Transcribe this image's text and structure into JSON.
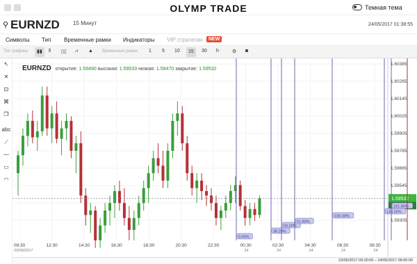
{
  "app": {
    "logo": "OLYMP TRADE",
    "theme_label": "Темная тема"
  },
  "header": {
    "symbol": "EURNZD",
    "timeframe_label": "15 Минут",
    "datetime": "24/05/2017 01:38:55"
  },
  "menu": {
    "symbols": "Символы",
    "type": "Тип",
    "timeframes": "Временные рамки",
    "indicators": "Индикаторы",
    "vip": "VIP стратегии",
    "new_badge": "NEW"
  },
  "toolbar": {
    "chart_type_label": "Тип графика",
    "timeframe_label": "Временные рамки",
    "timeframes": [
      "1",
      "5",
      "10",
      "15",
      "30",
      "h"
    ],
    "active_timeframe": "15"
  },
  "legend": {
    "symbol": "EURNZD",
    "open_label": "открытие:",
    "open": "1.59490",
    "high_label": "высокая:",
    "high": "1.59533",
    "low_label": "низкая:",
    "low": "1.59470",
    "close_label": "закрытие:",
    "close": "1.59532"
  },
  "axis": {
    "y_ticks": [
      "1.60385",
      "1.60265",
      "1.60145",
      "1.60025",
      "1.59905",
      "1.59785",
      "1.59665",
      "1.59545",
      "1.59425",
      "1.59305"
    ],
    "x_ticks": [
      {
        "t": "09:30",
        "sub": "23/05/2017"
      },
      {
        "t": "12:30",
        "sub": ""
      },
      {
        "t": "14:30",
        "sub": ""
      },
      {
        "t": "16:30",
        "sub": ""
      },
      {
        "t": "18:30",
        "sub": ""
      },
      {
        "t": "20:30",
        "sub": ""
      },
      {
        "t": "22:30",
        "sub": ""
      },
      {
        "t": "00:30",
        "sub": "24"
      },
      {
        "t": "02:30",
        "sub": "24"
      },
      {
        "t": "04:30",
        "sub": "24"
      },
      {
        "t": "06:30",
        "sub": "24"
      },
      {
        "t": "08:30",
        "sub": "24"
      }
    ],
    "current_price": "1.59532",
    "countdown": "06:05"
  },
  "fib_labels": [
    "0.00%",
    "38.20%",
    "50.00%",
    "61.80%",
    "100.00%",
    "138.20%",
    "161.80%"
  ],
  "bottom": {
    "range_text": "23/05/2017 09:30:00 – 24/05/2017 09:00:00"
  },
  "colors": {
    "up": "#3a9e3a",
    "down": "#b5303a",
    "fib": "#6a6ab0",
    "price_tag": "#3fb43f"
  },
  "chart_data": {
    "type": "candlestick",
    "series": [
      {
        "values": [
          [
            1.597,
            1.5985,
            1.5955,
            1.5982
          ],
          [
            1.5982,
            1.6,
            1.5975,
            1.5995
          ],
          [
            1.5995,
            1.601,
            1.5988,
            1.6005
          ],
          [
            1.6005,
            1.6012,
            1.599,
            1.5994
          ],
          [
            1.5994,
            1.6005,
            1.5985,
            1.5998
          ],
          [
            1.5998,
            1.6028,
            1.5995,
            1.6022
          ],
          [
            1.6022,
            1.6028,
            1.5995,
            1.6
          ],
          [
            1.6,
            1.6015,
            1.599,
            1.601
          ],
          [
            1.601,
            1.6018,
            1.599,
            1.5993
          ],
          [
            1.5993,
            1.6005,
            1.5982,
            1.6
          ],
          [
            1.6,
            1.601,
            1.5992,
            1.6005
          ],
          [
            1.6005,
            1.6008,
            1.598,
            1.5985
          ],
          [
            1.5985,
            1.5995,
            1.597,
            1.599
          ],
          [
            1.599,
            1.5998,
            1.595,
            1.5955
          ],
          [
            1.5955,
            1.596,
            1.5935,
            1.5942
          ],
          [
            1.5942,
            1.595,
            1.593,
            1.5945
          ],
          [
            1.5945,
            1.5948,
            1.592,
            1.5925
          ],
          [
            1.5925,
            1.594,
            1.592,
            1.5935
          ],
          [
            1.5935,
            1.595,
            1.593,
            1.5945
          ],
          [
            1.5945,
            1.5955,
            1.5935,
            1.595
          ],
          [
            1.595,
            1.5962,
            1.594,
            1.5958
          ],
          [
            1.5958,
            1.5965,
            1.5945,
            1.595
          ],
          [
            1.595,
            1.596,
            1.5935,
            1.594
          ],
          [
            1.594,
            1.5948,
            1.5925,
            1.5932
          ],
          [
            1.5932,
            1.5945,
            1.5925,
            1.594
          ],
          [
            1.594,
            1.5955,
            1.5935,
            1.595
          ],
          [
            1.595,
            1.5965,
            1.5945,
            1.596
          ],
          [
            1.596,
            1.5975,
            1.595,
            1.597
          ],
          [
            1.597,
            1.5985,
            1.5965,
            1.598
          ],
          [
            1.598,
            1.599,
            1.597,
            1.5975
          ],
          [
            1.5975,
            1.5985,
            1.596,
            1.5965
          ],
          [
            1.5965,
            1.599,
            1.596,
            1.5985
          ],
          [
            1.5985,
            1.601,
            1.598,
            1.6005
          ],
          [
            1.6005,
            1.6018,
            1.5995,
            1.601
          ],
          [
            1.601,
            1.6015,
            1.5985,
            1.599
          ],
          [
            1.599,
            1.5995,
            1.5965,
            1.597
          ],
          [
            1.597,
            1.5975,
            1.5955,
            1.596
          ],
          [
            1.596,
            1.597,
            1.595,
            1.5965
          ],
          [
            1.5965,
            1.597,
            1.5952,
            1.5958
          ],
          [
            1.5958,
            1.5962,
            1.5948,
            1.5955
          ],
          [
            1.5955,
            1.596,
            1.5945,
            1.595
          ],
          [
            1.595,
            1.5955,
            1.5935,
            1.594
          ],
          [
            1.594,
            1.5948,
            1.5932,
            1.5945
          ],
          [
            1.5945,
            1.5955,
            1.594,
            1.595
          ],
          [
            1.595,
            1.5962,
            1.5945,
            1.5958
          ],
          [
            1.5958,
            1.5968,
            1.595,
            1.5962
          ],
          [
            1.5962,
            1.5965,
            1.5945,
            1.5948
          ],
          [
            1.5948,
            1.5952,
            1.5935,
            1.594
          ],
          [
            1.594,
            1.595,
            1.5935,
            1.5946
          ],
          [
            1.5946,
            1.595,
            1.5938,
            1.5942
          ],
          [
            1.5942,
            1.5955,
            1.594,
            1.5953
          ]
        ]
      }
    ],
    "ylim": [
      1.5925,
      1.6045
    ]
  }
}
